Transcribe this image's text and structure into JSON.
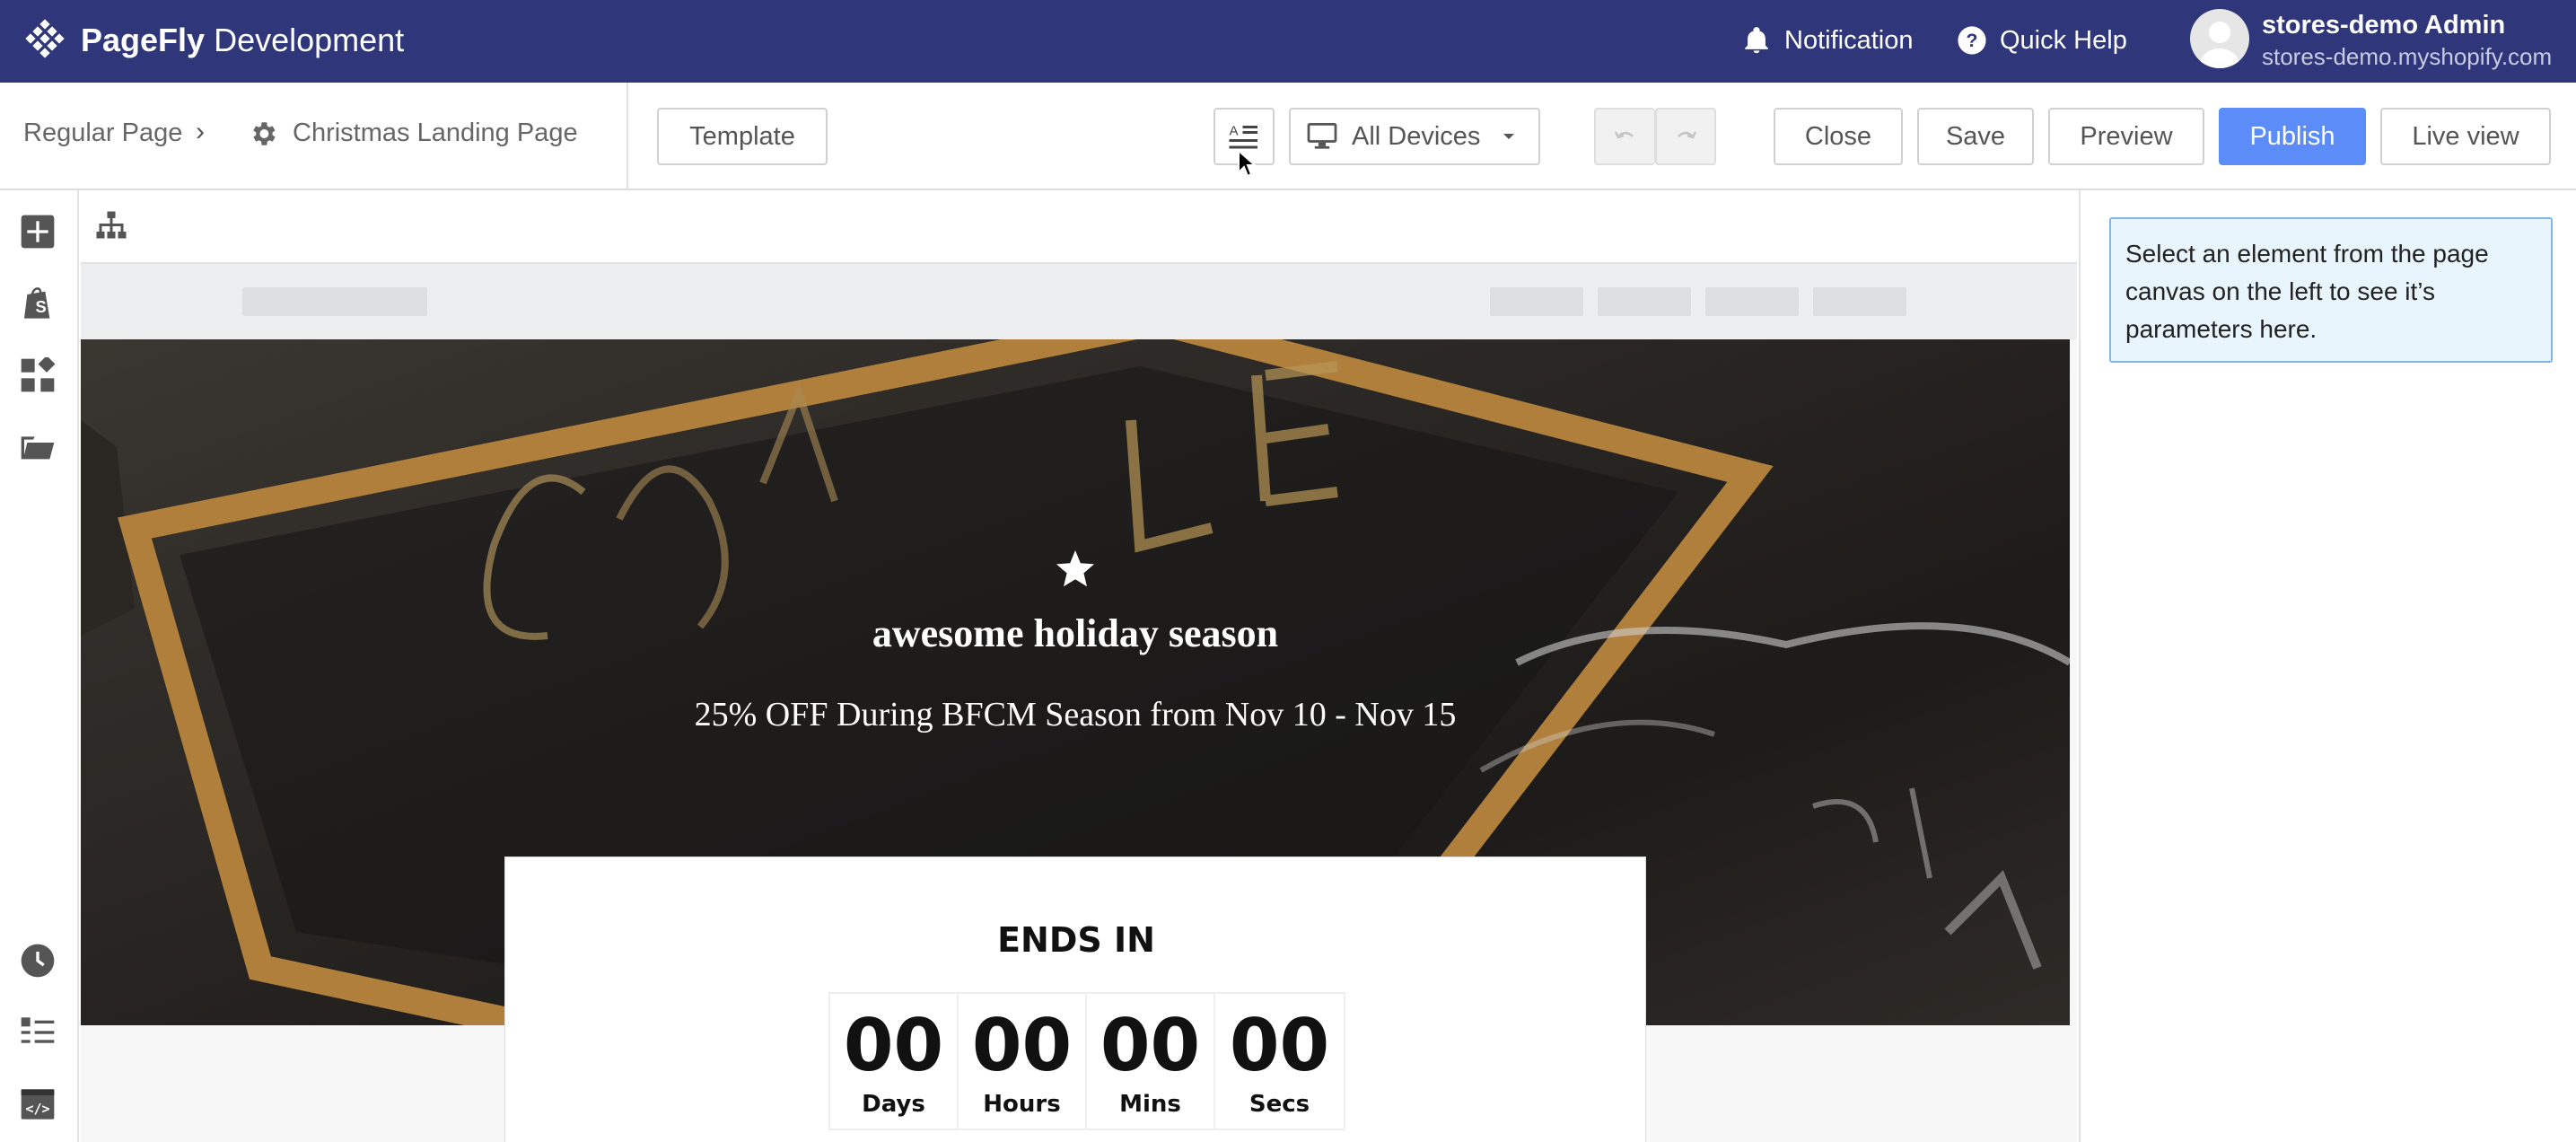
{
  "app": {
    "brand_bold": "PageFly",
    "brand_rest": " Development"
  },
  "topbar": {
    "notification_label": "Notification",
    "help_label": "Quick Help",
    "user_name": "stores-demo Admin",
    "user_store": "stores-demo.myshopify.com",
    "background_color": "#2f3679"
  },
  "breadcrumb": {
    "parent": "Regular Page",
    "separator": "›",
    "current": "Christmas Landing Page"
  },
  "toolbar": {
    "template_label": "Template",
    "device_label": "All Devices",
    "close_label": "Close",
    "save_label": "Save",
    "preview_label": "Preview",
    "publish_label": "Publish",
    "live_view_label": "Live view",
    "publish_color": "#5b8cf7"
  },
  "sidebar": {
    "icons": [
      "add-icon",
      "shopify-bag-icon",
      "elements-icon",
      "folder-icon",
      "history-icon",
      "list-icon",
      "code-icon"
    ]
  },
  "canvas": {
    "hero_title": "awesome holiday season",
    "hero_subtitle": "25% OFF During BFCM Season from Nov 10 - Nov 15",
    "countdown_title": "ENDS IN",
    "countdown": [
      {
        "value": "00",
        "label": "Days"
      },
      {
        "value": "00",
        "label": "Hours"
      },
      {
        "value": "00",
        "label": "Mins"
      },
      {
        "value": "00",
        "label": "Secs"
      }
    ]
  },
  "inspector": {
    "hint": "Select an element from the page canvas on the left to see it’s parameters here."
  }
}
